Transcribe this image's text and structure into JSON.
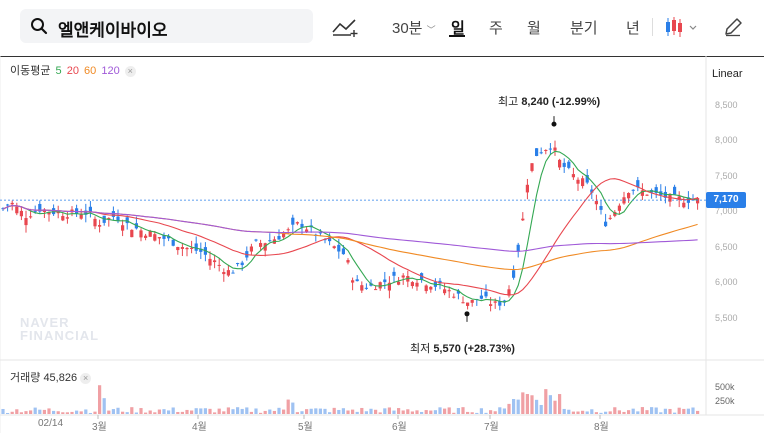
{
  "search": {
    "query": "엘앤케이바이오"
  },
  "toolbar": {
    "interval": "30분",
    "periods": [
      "일",
      "주",
      "월",
      "분기",
      "년"
    ],
    "active_period": "일"
  },
  "ma_legend": {
    "label": "이동평균",
    "periods": [
      {
        "value": "5",
        "color": "#34a853"
      },
      {
        "value": "20",
        "color": "#e8474f"
      },
      {
        "value": "60",
        "color": "#f08a24"
      },
      {
        "value": "120",
        "color": "#a05ad8"
      }
    ]
  },
  "scale_label": "Linear",
  "current_price": "7,170",
  "annotations": {
    "high": {
      "label": "최고",
      "value": "8,240",
      "pct": "(-12.99%)"
    },
    "low": {
      "label": "최저",
      "value": "5,570",
      "pct": "(+28.73%)"
    }
  },
  "watermark": [
    "NAVER",
    "FINANCIAL"
  ],
  "volume": {
    "label": "거래량",
    "value": "45,826",
    "ticks": [
      "500k",
      "250k"
    ]
  },
  "chart_data": {
    "type": "candlestick",
    "ylim": [
      5300,
      8650
    ],
    "y_ticks": [
      "8,500",
      "8,000",
      "7,500",
      "7,000",
      "6,500",
      "6,000",
      "5,500"
    ],
    "x_labels": [
      "02/14",
      "3월",
      "4월",
      "5월",
      "6월",
      "7월",
      "8월"
    ],
    "high": 8240,
    "low": 5570,
    "last": 7170,
    "up_color": "#e8474f",
    "down_color": "#2a7fe8"
  }
}
